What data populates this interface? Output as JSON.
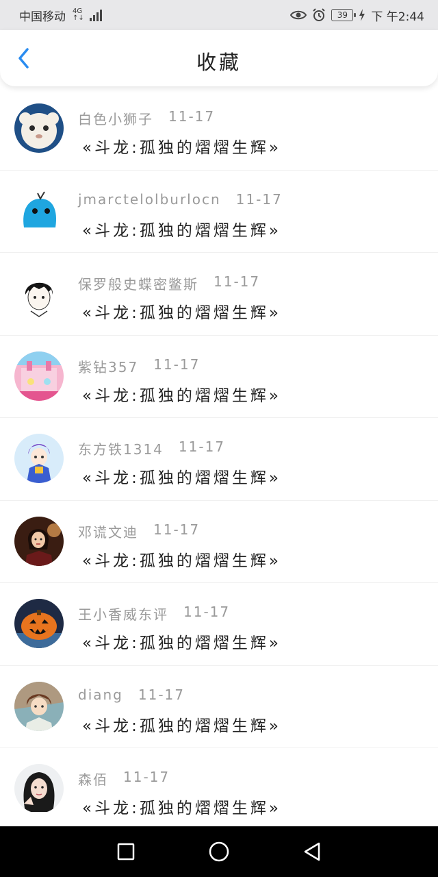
{
  "status_bar": {
    "carrier": "中国移动",
    "network": "4G",
    "battery": "39",
    "time": "下 午2:44",
    "icons": [
      "signal-icon",
      "eye-icon",
      "alarm-icon",
      "battery-icon",
      "charging-icon"
    ]
  },
  "header": {
    "title": "收藏",
    "back_icon": "chevron-left-icon",
    "accent_color": "#2a8cf0"
  },
  "favorites": [
    {
      "user": "白色小狮子",
      "date": "11-17",
      "work": "«斗龙:孤独的熠熠生辉»",
      "avatar": "white-lion-avatar"
    },
    {
      "user": "jmarctelolburlocn",
      "date": "11-17",
      "work": "«斗龙:孤独的熠熠生辉»",
      "avatar": "blue-creature-avatar"
    },
    {
      "user": "保罗般史蝶密鳖斯",
      "date": "11-17",
      "work": "«斗龙:孤独的熠熠生辉»",
      "avatar": "anime-boy-avatar"
    },
    {
      "user": "紫钻357",
      "date": "11-17",
      "work": "«斗龙:孤独的熠熠生辉»",
      "avatar": "pink-castle-avatar"
    },
    {
      "user": "东方铁1314",
      "date": "11-17",
      "work": "«斗龙:孤独的熠熠生辉»",
      "avatar": "anime-warrior-avatar"
    },
    {
      "user": "邓谎文迪",
      "date": "11-17",
      "work": "«斗龙:孤独的熠熠生辉»",
      "avatar": "woman-portrait-avatar"
    },
    {
      "user": "王小香威东评",
      "date": "11-17",
      "work": "«斗龙:孤独的熠熠生辉»",
      "avatar": "pumpkin-avatar"
    },
    {
      "user": "diang",
      "date": "11-17",
      "work": "«斗龙:孤独的熠熠生辉»",
      "avatar": "anime-character-avatar"
    },
    {
      "user": "森佰",
      "date": "11-17",
      "work": "«斗龙:孤独的熠熠生辉»",
      "avatar": "girl-portrait-avatar"
    }
  ],
  "nav_bar": {
    "buttons": [
      "recent-apps-icon",
      "home-icon",
      "back-icon"
    ]
  }
}
